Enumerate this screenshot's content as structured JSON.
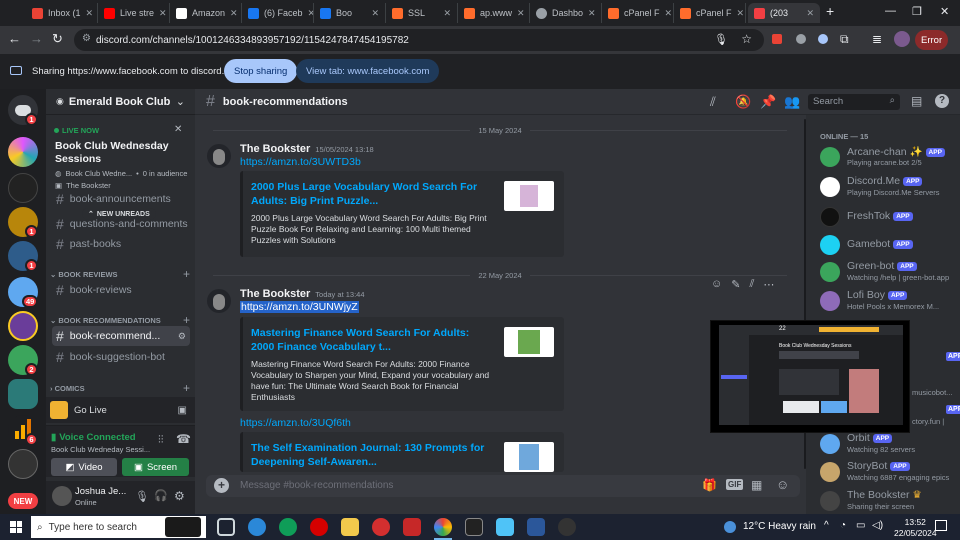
{
  "browser": {
    "tabs": [
      {
        "label": "Inbox (1",
        "color": "#ea4335"
      },
      {
        "label": "Live stre",
        "color": "#ff0000"
      },
      {
        "label": "Amazon",
        "color": "#ffffff"
      },
      {
        "label": "(6) Faceb",
        "color": "#1877f2"
      },
      {
        "label": "Boo",
        "color": "#1877f2"
      },
      {
        "label": "SSL",
        "color": "#ff6c2c"
      },
      {
        "label": "ap.www",
        "color": "#ff6c2c"
      },
      {
        "label": "Dashbo",
        "color": "#9aa0a6"
      },
      {
        "label": "cPanel F",
        "color": "#ff6c2c"
      },
      {
        "label": "cPanel F",
        "color": "#ff6c2c"
      },
      {
        "label": "(203",
        "color": "#f23f43"
      }
    ],
    "url": "discord.com/channels/1001246334893957192/1154247847454195782",
    "profile_label": "Error"
  },
  "share_bar": {
    "text": "Sharing https://www.facebook.com to discord.com",
    "stop_label": "Stop sharing",
    "view_label": "View tab: www.facebook.com"
  },
  "rail": {
    "badges": [
      "1",
      "1",
      "1",
      "1",
      "49",
      "2",
      "6"
    ],
    "new_label": "NEW"
  },
  "server": {
    "name": "Emerald Book Club",
    "live_label": "LIVE NOW",
    "event_title": "Book Club Wednesday Sessions",
    "event_channel": "Book Club Wedne...",
    "event_audience": "0 in audience",
    "event_host": "The Bookster",
    "new_unreads": "NEW UNREADS",
    "channels_top": [
      "book-announcements",
      "questions-and-comments",
      "past-books"
    ],
    "categories": [
      "BOOK REVIEWS",
      "BOOK RECOMMENDATIONS",
      "COMICS"
    ],
    "channel_reviews": "book-reviews",
    "channel_recs_active": "book-recommend...",
    "channel_suggest": "book-suggestion-bot",
    "go_live": "Go Live",
    "voice_status": "Voice Connected",
    "voice_channel": "Book Club Wedneday Sessi...",
    "video_label": "Video",
    "screen_label": "Screen",
    "user_name": "Joshua Je...",
    "user_status": "Online"
  },
  "channel": {
    "name": "book-recommendations",
    "search_placeholder": "Search",
    "input_placeholder": "Message #book-recommendations"
  },
  "messages": {
    "date1": "15 May 2024",
    "date2": "22 May 2024",
    "author": "The Bookster",
    "time1": "15/05/2024 13:18",
    "time2": "Today at 13:44",
    "link1": "https://amzn.to/3UWTD3b",
    "embed1_title": "2000 Plus Large Vocabulary Word Search For Adults: Big Print Puzzle...",
    "embed1_desc": "2000 Plus Large Vocabulary Word Search For Adults: Big Print Puzzle Book For Relaxing and Learning: 100 Multi themed Puzzles with Solutions",
    "link2": "https://amzn.to/3UNWjyZ",
    "embed2_title": "Mastering Finance Word Search For Adults: 2000 Finance Vocabulary t...",
    "embed2_desc": "Mastering Finance Word Search For Adults: 2000 Finance Vocabulary to Sharpen your Mind, Expand your vocabulary and have fun: The Ultimate Word Search Book for Financial Enthusiasts",
    "link3": "https://amzn.to/3UQf6th",
    "embed3_title": "The Self Examination Journal: 130 Prompts for Deepening Self-Awaren..."
  },
  "members": {
    "header": "ONLINE — 15",
    "app_tag": "APP",
    "list": [
      {
        "name": "Arcane-chan",
        "status": "Playing arcane.bot 2/5",
        "color": "#3ba55c"
      },
      {
        "name": "Discord.Me",
        "status": "Playing Discord.Me Servers",
        "color": "#ffffff"
      },
      {
        "name": "FreshTok",
        "status": "",
        "color": "#111111"
      },
      {
        "name": "Gamebot",
        "status": "",
        "color": "#1dd1f2"
      },
      {
        "name": "Green-bot",
        "status": "Watching /help | green-bot.app",
        "color": "#3ba55c"
      },
      {
        "name": "Lofi Boy",
        "status": "Hotel Pools x Memorex M...",
        "color": "#8e6bb8"
      },
      {
        "name": "Orbit",
        "status": "Watching 82 servers",
        "color": "#5fa8f0"
      },
      {
        "name": "StoryBot",
        "status": "Watching 6887 engaging epics",
        "color": "#c7a56b"
      },
      {
        "name": "The Bookster",
        "status": "Sharing their screen",
        "color": "#444444"
      }
    ],
    "partial_status_1": "musicobot...",
    "partial_status_2": "ctory.fun |"
  },
  "pip": {
    "label": "22",
    "title": "Book Club Wednesday Sessions"
  },
  "taskbar": {
    "search_placeholder": "Type here to search",
    "weather": "12°C  Heavy rain",
    "time": "13:52",
    "date": "22/05/2024"
  }
}
